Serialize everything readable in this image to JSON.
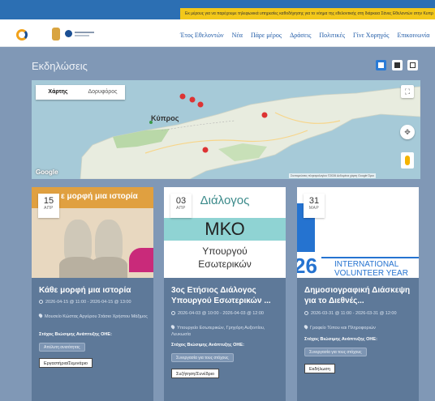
{
  "topbar": {
    "notice": "Εκ μέρους για να παρέχουμε τηλεφωνικά υπηρεσίες καθοδήγησης για το νόημα της εθελοντικής στη διάρκεια Σάνες Εθελοντών στην Κυπρ"
  },
  "header": {
    "nav": [
      "Έτος Εθελοντών",
      "Νέα",
      "Πάρε μέρος",
      "Δράσεις",
      "Πολιτικές",
      "Γίνε Χορηγός",
      "Επικοινωνία"
    ]
  },
  "page": {
    "title": "Εκδηλώσεις"
  },
  "map": {
    "tabs": [
      "Χάρτης",
      "Δορυφόρος"
    ],
    "label": "Κύπρος",
    "google": "Google",
    "attribution": "Συντομεύσεις πληκτρολογίου   ©2026 Δεδομένα χάρτη Google   Όροι"
  },
  "events": [
    {
      "day": "15",
      "month": "ΑΠΡ",
      "image_text": "ε μορφή μια ιστορία",
      "title": "Κάθε μορφή μια ιστορία",
      "datetime": "2026-04-15 @ 11:00 - 2026-04-15 @ 13:00",
      "location": "Μουσείο Κώστας Αργύρου Στάσιο Χρήστου Μάξιμος",
      "goals_label": "Στόχος Βιώσιμης Ανάπτυξης ΟΗΕ:",
      "goal_tag": "Απέλυτη ανισότητας",
      "type": "Εργαστήρια/Σεμινάριο"
    },
    {
      "day": "03",
      "month": "ΑΠΡ",
      "image_lines": [
        "Διάλογος",
        "ΜΚΟ",
        "Υπουργού",
        "Εσωτερικών"
      ],
      "title": "3ος Ετήσιος Διάλογος Υπουργού Εσωτερικών ...",
      "datetime": "2026-04-03 @ 10:00 - 2026-04-03 @ 12:00",
      "location": "Υπουργείο Εσωτερικών, Γρηγόρη Αυξεντίου, Λευκωσία",
      "goals_label": "Στόχος Βιώσιμης Ανάπτυξης ΟΗΕ:",
      "goal_tag": "Συνεργασία για τους στόχους",
      "type": "Συζήτηση/Συνέδριο"
    },
    {
      "day": "31",
      "month": "ΜΑΡ",
      "image_lines": [
        "26",
        "INTERNATIONAL",
        "VOLUNTEER YEAR"
      ],
      "title": "Δημοσιογραφική Διάσκεψη για το Διεθνές...",
      "datetime": "2026-03-31 @ 11:00 - 2026-03-31 @ 12:00",
      "location": "Γραφείο Τύπου και Πληροφοριών",
      "goals_label": "Στόχος Βιώσιμης Ανάπτυξης ΟΗΕ:",
      "goal_tag": "Συνεργασία για τους στόχους",
      "type": "Εκδήλωση"
    }
  ],
  "colors": {
    "background": "#8098b6",
    "card": "#5e7999",
    "accent": "#2a7bd6",
    "notice": "#f3c81a",
    "nav": "#1f5aa6"
  }
}
